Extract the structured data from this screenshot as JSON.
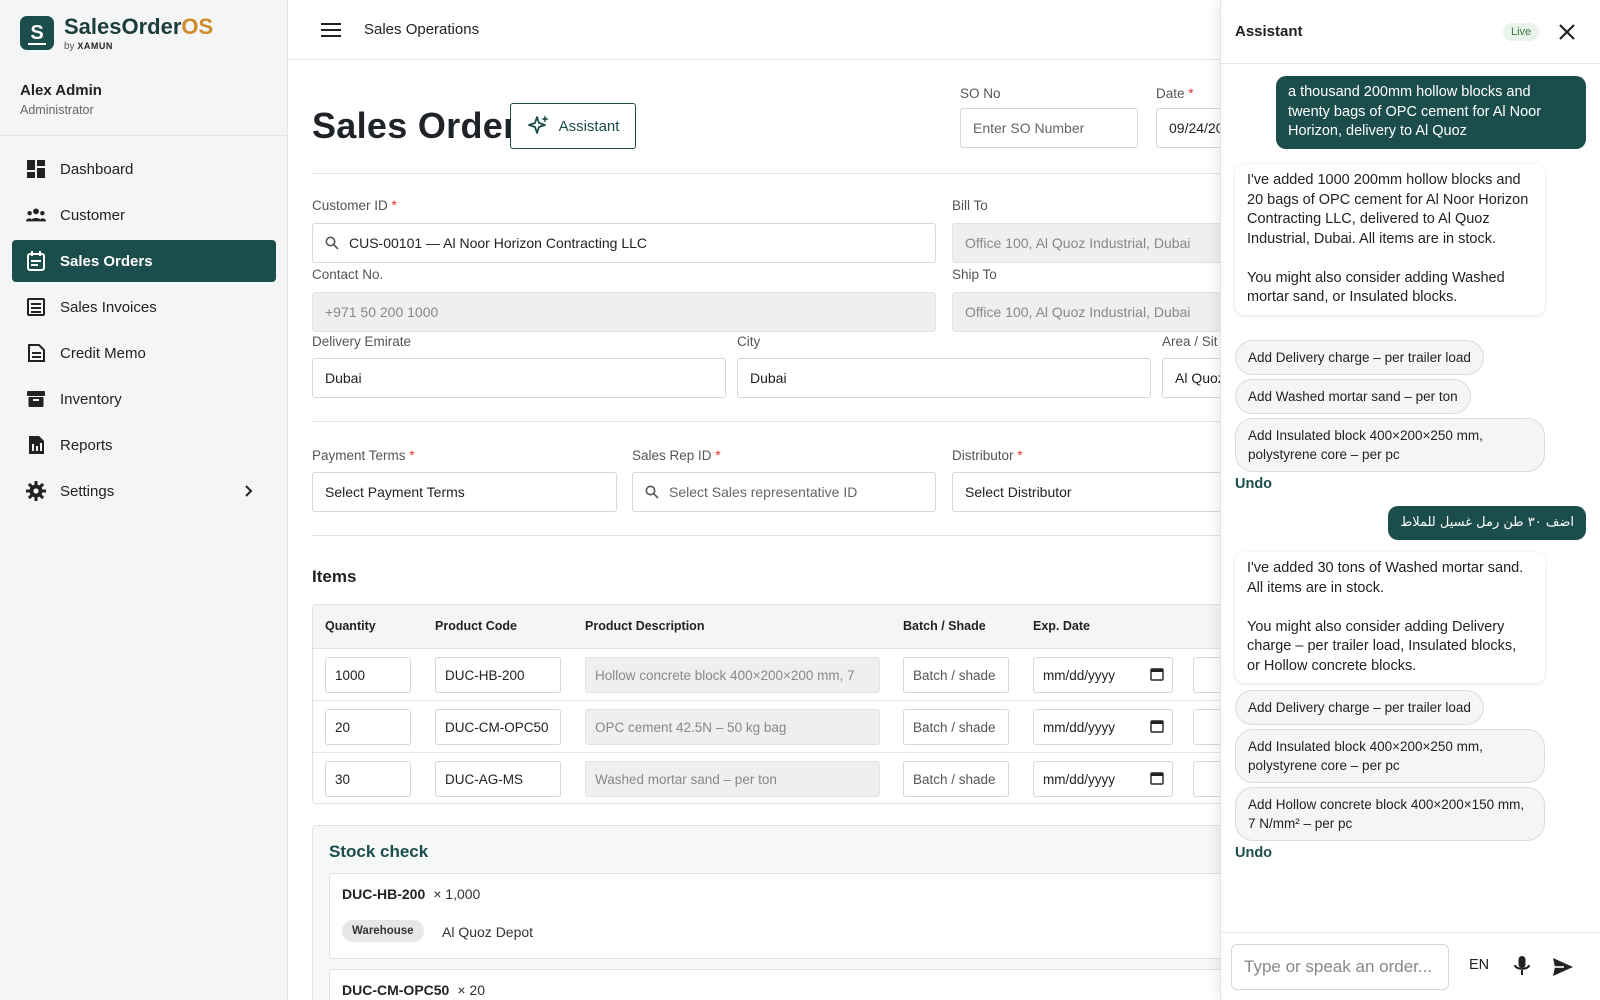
{
  "brand": {
    "logo_letter": "S",
    "name_main": "SalesOrder",
    "name_accent": "OS",
    "by": "by",
    "by_company": "XAMUN"
  },
  "user": {
    "name": "Alex Admin",
    "role": "Administrator"
  },
  "nav": {
    "dashboard": "Dashboard",
    "customer": "Customer",
    "sales_orders": "Sales Orders",
    "sales_invoices": "Sales Invoices",
    "credit_memo": "Credit Memo",
    "inventory": "Inventory",
    "reports": "Reports",
    "settings": "Settings",
    "active": "Sales Orders"
  },
  "header": {
    "title": "Sales Operations"
  },
  "page": {
    "title": "Sales Order",
    "assistant_button": "Assistant",
    "so_no": {
      "label": "SO No",
      "placeholder": "Enter SO Number"
    },
    "date": {
      "label": "Date",
      "value": "09/24/20"
    }
  },
  "form": {
    "customer_id": {
      "label": "Customer ID",
      "value": "CUS-00101 — Al Noor Horizon Contracting LLC"
    },
    "bill_to": {
      "label": "Bill To",
      "value": "Office 100, Al Quoz Industrial, Dubai"
    },
    "contact_no": {
      "label": "Contact No.",
      "value": "+971 50 200 1000"
    },
    "ship_to": {
      "label": "Ship To",
      "value": "Office 100, Al Quoz Industrial, Dubai"
    },
    "delivery_emirate": {
      "label": "Delivery Emirate",
      "value": "Dubai"
    },
    "city": {
      "label": "City",
      "value": "Dubai"
    },
    "area_site": {
      "label": "Area / Sit",
      "value": "Al Quoz"
    },
    "payment_terms": {
      "label": "Payment Terms",
      "value": "Select Payment Terms"
    },
    "sales_rep": {
      "label": "Sales Rep ID",
      "placeholder": "Select Sales representative ID"
    },
    "distributor": {
      "label": "Distributor",
      "value": "Select Distributor"
    },
    "required_mark": "*"
  },
  "items": {
    "title": "Items",
    "columns": {
      "quantity": "Quantity",
      "product_code": "Product Code",
      "product_description": "Product Description",
      "batch_shade": "Batch / Shade",
      "exp_date": "Exp. Date"
    },
    "rows": [
      {
        "quantity": "1000",
        "code": "DUC-HB-200",
        "description": "Hollow concrete block 400×200×200 mm, 7",
        "batch": "Batch / shade",
        "exp": "mm/dd/yyyy"
      },
      {
        "quantity": "20",
        "code": "DUC-CM-OPC50",
        "description": "OPC cement 42.5N – 50 kg bag",
        "batch": "Batch / shade",
        "exp": "mm/dd/yyyy"
      },
      {
        "quantity": "30",
        "code": "DUC-AG-MS",
        "description": "Washed mortar sand – per ton",
        "batch": "Batch / shade",
        "exp": "mm/dd/yyyy"
      }
    ]
  },
  "stock": {
    "title": "Stock check",
    "cards": [
      {
        "code": "DUC-HB-200",
        "qty": "× 1,000",
        "badge": "Warehouse",
        "warehouse": "Al Quoz Depot"
      },
      {
        "code": "DUC-CM-OPC50",
        "qty": "× 20"
      }
    ]
  },
  "assistant": {
    "title": "Assistant",
    "status": "Live",
    "messages": {
      "user1": "a thousand 200mm hollow blocks and twenty bags of OPC cement for Al Noor Horizon, delivery to Al Quoz",
      "bot1": "I've added 1000 200mm hollow blocks and 20 bags of OPC cement for Al Noor Horizon Contracting LLC, delivered to Al Quoz Industrial, Dubai. All items are in stock.\n\nYou might also consider adding Washed mortar sand, or Insulated blocks.",
      "chips1": [
        "Add Delivery charge – per trailer load",
        "Add Washed mortar sand – per ton",
        "Add Insulated block 400×200×250 mm, polystyrene core – per pc"
      ],
      "undo": "Undo",
      "user2": "اضف ٣٠ طن رمل غسيل للملاط",
      "bot2": "I've added 30 tons of Washed mortar sand. All items are in stock.\n\nYou might also consider adding Delivery charge – per trailer load, Insulated blocks, or Hollow concrete blocks.",
      "chips2": [
        "Add Delivery charge – per trailer load",
        "Add Insulated block 400×200×250 mm, polystyrene core – per pc",
        "Add Hollow concrete block 400×200×150 mm, 7 N/mm² – per pc"
      ]
    },
    "input_placeholder": "Type or speak an order...",
    "language": "EN"
  },
  "colors": {
    "brand": "#1b4d4c",
    "brand_accent": "#d08a2c",
    "required": "#dd3333"
  }
}
